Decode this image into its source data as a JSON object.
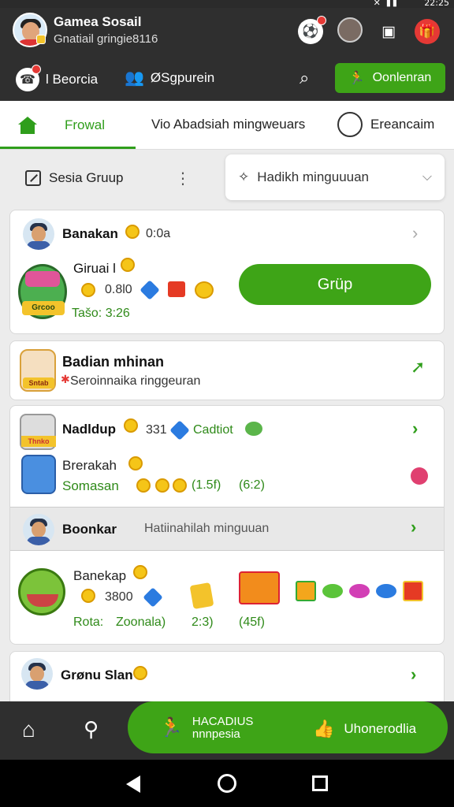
{
  "status": {
    "time": "22:25"
  },
  "header": {
    "title": "Gamea Sosail",
    "subtitle": "Gnatiail gringie8116",
    "row2_left": "l Beorcia",
    "row2_mid": "ØSgpurein",
    "download_label": "Oonlenran"
  },
  "tabs": [
    {
      "label": "Frowal"
    },
    {
      "label": "Vio Abadsiah mingweuars"
    },
    {
      "label": "Ereancaim"
    }
  ],
  "filter": {
    "group_label": "Sesia Gruup",
    "search_placeholder": "Hadikh minguuuan"
  },
  "cards": {
    "c1": {
      "name": "Banakan",
      "time": "0:0a",
      "game_title": "Giruai l",
      "art_label": "Grcoo",
      "value": "0.8l0",
      "tag": "Tašo: 3:26",
      "button": "Grüp"
    },
    "c2": {
      "title": "Badian mhinan",
      "sub": "Seroinnaika ringgeuran",
      "art_label": "Sntab"
    },
    "c3": {
      "name": "Nadldup",
      "value": "331",
      "label": "Cadtiot",
      "art_label": "Thnko"
    },
    "c4": {
      "title": "Brerakah",
      "sub": "Somasan",
      "v1": "(1.5f)",
      "v2": "(6:2)"
    },
    "c5": {
      "name": "Boonkar",
      "sub": "Hatiinahilah minguuan"
    },
    "c6": {
      "title": "Banekap",
      "value": "3800",
      "rota": "Rota:",
      "zone": "Zoonala)",
      "v1": "2:3)",
      "v2": "(45f)"
    },
    "c7": {
      "name": "Grønu Slan"
    }
  },
  "bottom_nav": {
    "btn_a_line1": "HACADIUS",
    "btn_a_line2": "nnnpesia",
    "btn_b": "Uhonerodlia"
  }
}
